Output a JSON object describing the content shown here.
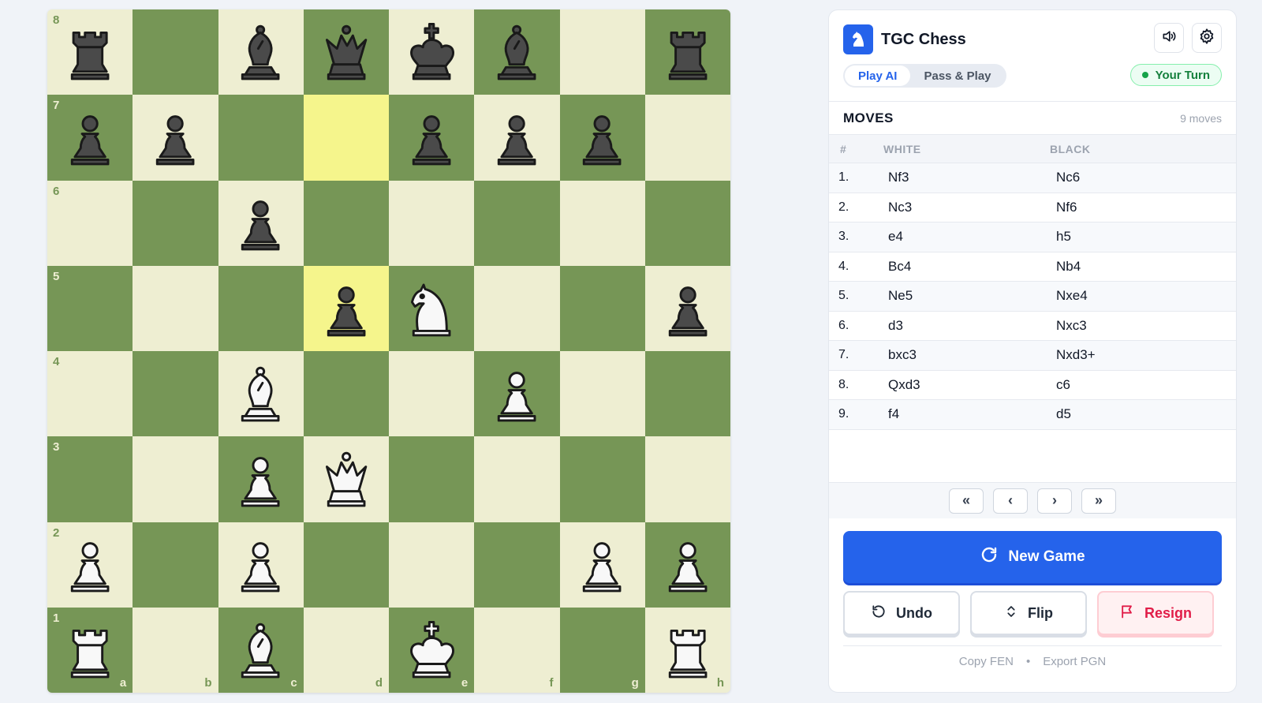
{
  "board": {
    "files": [
      "a",
      "b",
      "c",
      "d",
      "e",
      "f",
      "g",
      "h"
    ],
    "ranks": [
      "8",
      "7",
      "6",
      "5",
      "4",
      "3",
      "2",
      "1"
    ],
    "highlight": [
      "d7",
      "d5"
    ],
    "pieces": {
      "a8": "bR",
      "c8": "bB",
      "d8": "bQ",
      "e8": "bK",
      "f8": "bB",
      "h8": "bR",
      "a7": "bP",
      "b7": "bP",
      "e7": "bP",
      "f7": "bP",
      "g7": "bP",
      "c6": "bP",
      "d5": "bP",
      "e5": "wN",
      "h5": "bP",
      "c4": "wB",
      "f4": "wP",
      "c3": "wP",
      "d3": "wQ",
      "a2": "wP",
      "c2": "wP",
      "g2": "wP",
      "h2": "wP",
      "a1": "wR",
      "c1": "wB",
      "e1": "wK",
      "h1": "wR"
    }
  },
  "header": {
    "title": "TGC Chess",
    "logo_icon": "knight-icon",
    "sound_icon": "speaker-icon",
    "settings_icon": "gear-icon"
  },
  "modes": {
    "play_ai": "Play AI",
    "pass_play": "Pass & Play",
    "active": "Play AI"
  },
  "status": {
    "turn": "Your Turn",
    "color": "#16a34a"
  },
  "moves": {
    "title": "MOVES",
    "count": "9 moves",
    "headers": {
      "num": "#",
      "white": "WHITE",
      "black": "BLACK"
    },
    "rows": [
      {
        "num": "1.",
        "white": "Nf3",
        "black": "Nc6"
      },
      {
        "num": "2.",
        "white": "Nc3",
        "black": "Nf6"
      },
      {
        "num": "3.",
        "white": "e4",
        "black": "h5"
      },
      {
        "num": "4.",
        "white": "Bc4",
        "black": "Nb4"
      },
      {
        "num": "5.",
        "white": "Ne5",
        "black": "Nxe4"
      },
      {
        "num": "6.",
        "white": "d3",
        "black": "Nxc3"
      },
      {
        "num": "7.",
        "white": "bxc3",
        "black": "Nxd3+"
      },
      {
        "num": "8.",
        "white": "Qxd3",
        "black": "c6"
      },
      {
        "num": "9.",
        "white": "f4",
        "black": "d5"
      }
    ]
  },
  "nav": {
    "first": "«",
    "prev": "‹",
    "next": "›",
    "last": "»"
  },
  "actions": {
    "new_game": "New Game",
    "undo": "Undo",
    "flip": "Flip",
    "resign": "Resign"
  },
  "footer": {
    "copy_fen": "Copy FEN",
    "separator": "•",
    "export_pgn": "Export PGN"
  },
  "colors": {
    "accent": "#2563eb",
    "light_square": "#eeeed2",
    "dark_square": "#769656",
    "highlight": "#f5f58c",
    "danger": "#e11d48"
  }
}
